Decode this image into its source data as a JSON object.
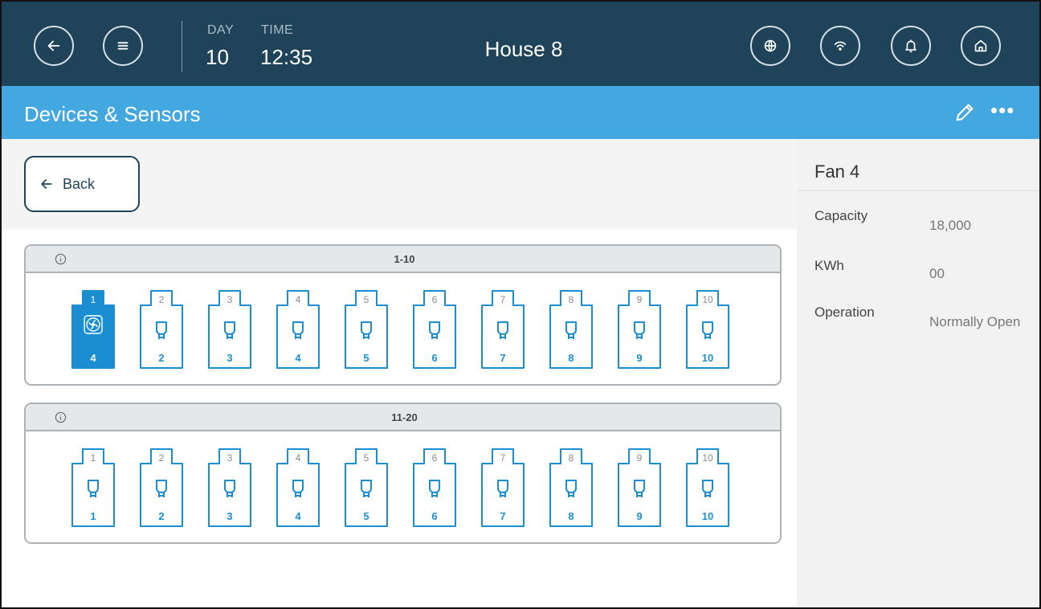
{
  "header": {
    "day_label": "DAY",
    "day_value": "10",
    "time_label": "TIME",
    "time_value": "12:35",
    "title": "House 8",
    "icons": [
      "back-arrow-icon",
      "menu-icon",
      "globe-icon",
      "wifi-icon",
      "bell-icon",
      "home-icon"
    ]
  },
  "section": {
    "title": "Devices & Sensors",
    "more_label": "•••"
  },
  "back_button": {
    "label": "Back"
  },
  "groups": [
    {
      "range": "1-10",
      "slots": [
        {
          "num": "1",
          "value": "4",
          "type": "fan",
          "active": true
        },
        {
          "num": "2",
          "value": "2",
          "type": "sensor"
        },
        {
          "num": "3",
          "value": "3",
          "type": "sensor"
        },
        {
          "num": "4",
          "value": "4",
          "type": "sensor"
        },
        {
          "num": "5",
          "value": "5",
          "type": "sensor"
        },
        {
          "num": "6",
          "value": "6",
          "type": "sensor"
        },
        {
          "num": "7",
          "value": "7",
          "type": "sensor"
        },
        {
          "num": "8",
          "value": "8",
          "type": "sensor"
        },
        {
          "num": "9",
          "value": "9",
          "type": "sensor"
        },
        {
          "num": "10",
          "value": "10",
          "type": "sensor"
        }
      ]
    },
    {
      "range": "11-20",
      "slots": [
        {
          "num": "1",
          "value": "1",
          "type": "sensor"
        },
        {
          "num": "2",
          "value": "2",
          "type": "sensor"
        },
        {
          "num": "3",
          "value": "3",
          "type": "sensor"
        },
        {
          "num": "4",
          "value": "4",
          "type": "sensor"
        },
        {
          "num": "5",
          "value": "5",
          "type": "sensor"
        },
        {
          "num": "6",
          "value": "6",
          "type": "sensor"
        },
        {
          "num": "7",
          "value": "7",
          "type": "sensor"
        },
        {
          "num": "8",
          "value": "8",
          "type": "sensor"
        },
        {
          "num": "9",
          "value": "9",
          "type": "sensor"
        },
        {
          "num": "10",
          "value": "10",
          "type": "sensor"
        }
      ]
    }
  ],
  "detail": {
    "title": "Fan 4",
    "rows": [
      {
        "label": "Capacity",
        "value": "18,000"
      },
      {
        "label": "KWh",
        "value": "00"
      },
      {
        "label": "Operation",
        "value": "Normally Open"
      }
    ]
  },
  "colors": {
    "header_bg": "#1f4459",
    "section_bg": "#43a7e0",
    "accent": "#1b8ed2"
  }
}
